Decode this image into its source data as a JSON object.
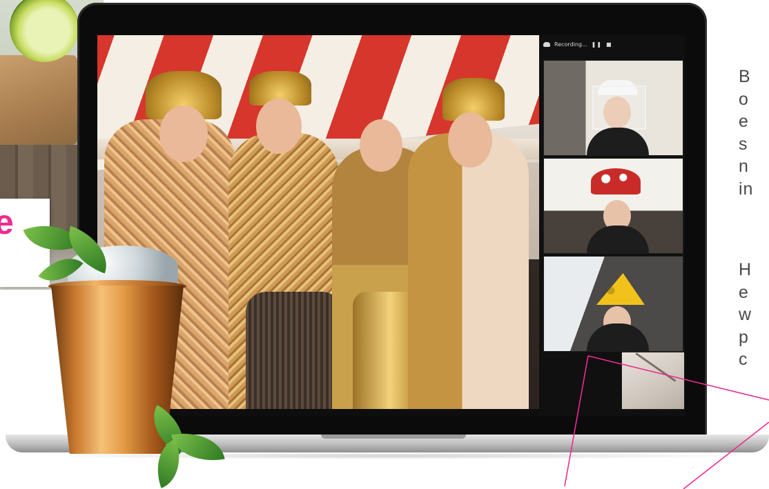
{
  "page": {
    "type": "marketing-hero",
    "accent_color": "#ee2a90"
  },
  "brand_fragment": {
    "text": "e"
  },
  "video_call": {
    "recording_label": "Recording...",
    "controls": [
      "pause-icon",
      "stop-icon"
    ],
    "participant_tiles": 4
  },
  "copy": {
    "paragraph1_lines": [
      "B",
      "o",
      "e",
      "s",
      "n",
      "in"
    ],
    "paragraph2_lines": [
      "H",
      "e",
      "w",
      "p",
      "c"
    ]
  },
  "icons": [
    "cloud-icon",
    "pause-icon",
    "stop-icon"
  ],
  "colors": {
    "callout_line": "#ee2a90",
    "laptop_bezel": "#0b0b0b",
    "cup_copper": "#c8782c"
  }
}
